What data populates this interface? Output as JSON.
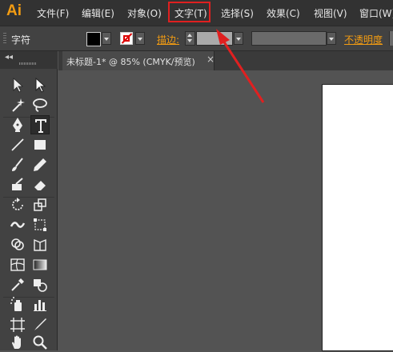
{
  "app": {
    "logo": "Ai"
  },
  "menu": {
    "items": [
      {
        "label": "文件(F)"
      },
      {
        "label": "编辑(E)"
      },
      {
        "label": "对象(O)"
      },
      {
        "label": "文字(T)"
      },
      {
        "label": "选择(S)"
      },
      {
        "label": "效果(C)"
      },
      {
        "label": "视图(V)"
      },
      {
        "label": "窗口(W)"
      }
    ],
    "highlighted": "文字(T)"
  },
  "control_bar": {
    "panel_label": "字符",
    "fill_color": "#000000",
    "stroke_label": "描边:",
    "stroke_weight": "",
    "opacity_label": "不透明度"
  },
  "toolbox": {
    "collapse_glyph": "◂◂",
    "tools": [
      {
        "icon": "selection-tool-icon"
      },
      {
        "icon": "direct-selection-tool-icon"
      },
      {
        "icon": "magic-wand-tool-icon"
      },
      {
        "icon": "lasso-tool-icon"
      },
      {
        "icon": "pen-tool-icon"
      },
      {
        "icon": "type-tool-icon",
        "active": true
      },
      {
        "icon": "line-tool-icon"
      },
      {
        "icon": "rectangle-tool-icon"
      },
      {
        "icon": "paintbrush-tool-icon"
      },
      {
        "icon": "pencil-tool-icon"
      },
      {
        "icon": "blob-brush-tool-icon"
      },
      {
        "icon": "eraser-tool-icon"
      },
      {
        "icon": "rotate-tool-icon"
      },
      {
        "icon": "scale-tool-icon"
      },
      {
        "icon": "width-tool-icon"
      },
      {
        "icon": "free-transform-tool-icon"
      },
      {
        "icon": "shape-builder-tool-icon"
      },
      {
        "icon": "perspective-grid-tool-icon"
      },
      {
        "icon": "mesh-tool-icon"
      },
      {
        "icon": "gradient-tool-icon"
      },
      {
        "icon": "eyedropper-tool-icon"
      },
      {
        "icon": "blend-tool-icon"
      },
      {
        "icon": "symbol-sprayer-tool-icon"
      },
      {
        "icon": "column-graph-tool-icon"
      },
      {
        "icon": "artboard-tool-icon"
      },
      {
        "icon": "slice-tool-icon"
      },
      {
        "icon": "hand-tool-icon"
      },
      {
        "icon": "zoom-tool-icon"
      }
    ]
  },
  "document": {
    "tab_title": "未标题-1* @ 85% (CMYK/预览)",
    "close_glyph": "×"
  },
  "colors": {
    "accent": "#f39c12",
    "highlight": "#e02020",
    "menubar_bg": "#323232",
    "panel_bg": "#424242",
    "canvas_bg": "#535353"
  }
}
